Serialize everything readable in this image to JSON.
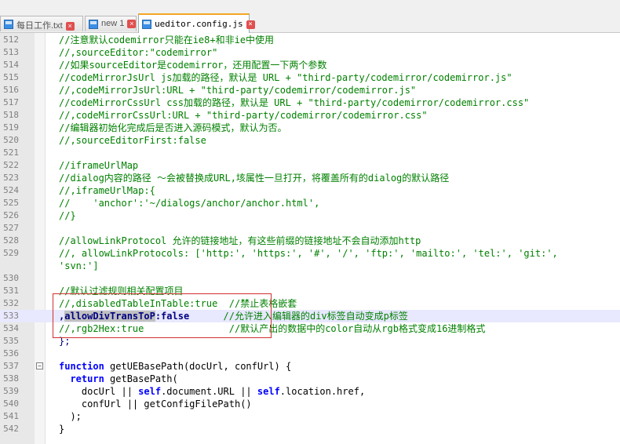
{
  "tabs": [
    {
      "label": "每日工作.txt",
      "active": false
    },
    {
      "label": "new 1",
      "active": false
    },
    {
      "label": "ueditor.config.js",
      "active": true
    }
  ],
  "lines": [
    {
      "n": "512",
      "text": "//注意默认codemirror只能在ie8+和非ie中使用"
    },
    {
      "n": "513",
      "text": "//,sourceEditor:\"codemirror\""
    },
    {
      "n": "514",
      "text": "//如果sourceEditor是codemirror，还用配置一下两个参数"
    },
    {
      "n": "515",
      "text": "//codeMirrorJsUrl js加载的路径，默认是 URL + \"third-party/codemirror/codemirror.js\""
    },
    {
      "n": "516",
      "text": "//,codeMirrorJsUrl:URL + \"third-party/codemirror/codemirror.js\""
    },
    {
      "n": "517",
      "text": "//codeMirrorCssUrl css加载的路径，默认是 URL + \"third-party/codemirror/codemirror.css\""
    },
    {
      "n": "518",
      "text": "//,codeMirrorCssUrl:URL + \"third-party/codemirror/codemirror.css\""
    },
    {
      "n": "519",
      "text": "//编辑器初始化完成后是否进入源码模式，默认为否。"
    },
    {
      "n": "520",
      "text": "//,sourceEditorFirst:false"
    },
    {
      "n": "521",
      "text": ""
    },
    {
      "n": "522",
      "text": "//iframeUrlMap"
    },
    {
      "n": "523",
      "text": "//dialog内容的路径 ～会被替换成URL,垓属性一旦打开，将覆盖所有的dialog的默认路径"
    },
    {
      "n": "524",
      "text": "//,iframeUrlMap:{"
    },
    {
      "n": "525",
      "text": "//    'anchor':'~/dialogs/anchor/anchor.html',"
    },
    {
      "n": "526",
      "text": "//}"
    },
    {
      "n": "527",
      "text": ""
    },
    {
      "n": "528",
      "text": "//allowLinkProtocol 允许的链接地址，有这些前缀的链接地址不会自动添加http"
    },
    {
      "n": "529",
      "text": "//, allowLinkProtocols: ['http:', 'https:', '#', '/', 'ftp:', 'mailto:', 'tel:', 'git:',"
    },
    {
      "n": "",
      "text": "'svn:']"
    },
    {
      "n": "530",
      "text": ""
    },
    {
      "n": "531",
      "text": "//默认过滤规则相关配置项目"
    },
    {
      "n": "532",
      "text": "//,disabledTableInTable:true  //禁止表格嵌套"
    },
    {
      "n": "533",
      "pre": ",",
      "sel": "allowDivTransToP",
      "post": ":false",
      "comment": "      //允许进入编辑器的div标签自动变成p标签"
    },
    {
      "n": "534",
      "text": "//,rgb2Hex:true               //默认产出的数据中的color自动从rgb格式变成16进制格式"
    },
    {
      "n": "535",
      "text": "};"
    },
    {
      "n": "536",
      "text": ""
    },
    {
      "n": "537",
      "text": "function getUEBasePath(docUrl, confUrl) {"
    },
    {
      "n": "538",
      "text": "  return getBasePath("
    },
    {
      "n": "539",
      "text": "    docUrl || self.document.URL || self.location.href,"
    },
    {
      "n": "540",
      "text": "    confUrl || getConfigFilePath()"
    },
    {
      "n": "541",
      "text": "  );"
    },
    {
      "n": "542",
      "text": "}"
    }
  ],
  "colors": {
    "comment": "#008000",
    "keyword": "#0000ff",
    "highlight": "#e8e8ff",
    "annotation": "#d03030"
  }
}
